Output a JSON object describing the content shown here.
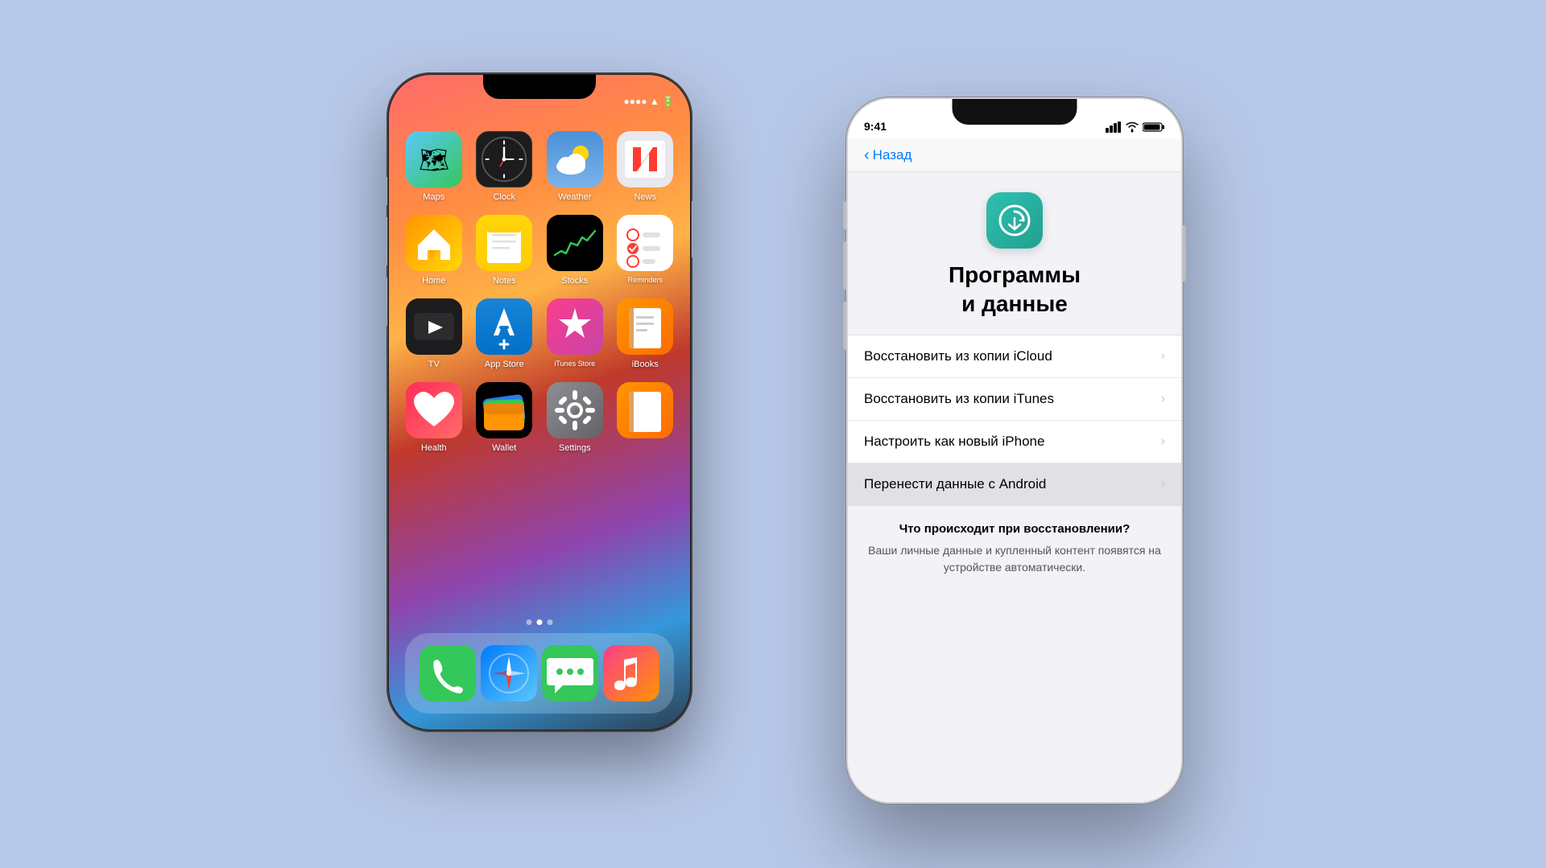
{
  "scene": {
    "background_color": "#b8c8e8"
  },
  "back_phone": {
    "apps_row1": [
      {
        "id": "maps",
        "label": "Maps",
        "bg_class": "maps-bg",
        "icon": "🗺️"
      },
      {
        "id": "clock",
        "label": "Clock",
        "bg_class": "clock-bg",
        "icon": "🕐"
      },
      {
        "id": "weather",
        "label": "Weather",
        "bg_class": "weather-bg",
        "icon": "⛅"
      },
      {
        "id": "news",
        "label": "News",
        "bg_class": "news-bg",
        "icon": "📰"
      }
    ],
    "apps_row2": [
      {
        "id": "home",
        "label": "Home",
        "bg_class": "home-bg",
        "icon": "🏠"
      },
      {
        "id": "notes",
        "label": "Notes",
        "bg_class": "notes-bg",
        "icon": "📝"
      },
      {
        "id": "stocks",
        "label": "Stocks",
        "bg_class": "stocks-bg",
        "icon": "📈"
      },
      {
        "id": "reminders",
        "label": "Reminders",
        "bg_class": "reminders-bg",
        "icon": "🔔"
      }
    ],
    "apps_row3": [
      {
        "id": "tv",
        "label": "TV",
        "bg_class": "tv-bg",
        "icon": "📺"
      },
      {
        "id": "appstore",
        "label": "App Store",
        "bg_class": "appstore-bg",
        "icon": "Ⓐ"
      },
      {
        "id": "itunes",
        "label": "iTunes Store",
        "bg_class": "itunes-bg",
        "icon": "⭐"
      },
      {
        "id": "ibooks",
        "label": "iBooks",
        "bg_class": "ibooks-bg",
        "icon": "📚"
      }
    ],
    "apps_row4": [
      {
        "id": "health",
        "label": "Health",
        "bg_class": "health-bg",
        "icon": "❤️"
      },
      {
        "id": "wallet",
        "label": "Wallet",
        "bg_class": "wallet-bg",
        "icon": "💳"
      },
      {
        "id": "settings",
        "label": "Settings",
        "bg_class": "settings-bg",
        "icon": "⚙️"
      },
      {
        "id": "extra",
        "label": "",
        "bg_class": "ibooks-bg",
        "icon": "📖"
      }
    ],
    "dock": [
      {
        "id": "phone",
        "label": "Phone",
        "bg_class": "phone-dock-bg",
        "icon": "📞"
      },
      {
        "id": "safari",
        "label": "Safari",
        "bg_class": "safari-dock-bg",
        "icon": "🧭"
      },
      {
        "id": "messages",
        "label": "Messages",
        "bg_class": "messages-dock-bg",
        "icon": "💬"
      },
      {
        "id": "music",
        "label": "Music",
        "bg_class": "music-dock-bg",
        "icon": "🎵"
      }
    ]
  },
  "front_phone": {
    "status_bar": {
      "time": "9:41",
      "signal_bars": "●●●●",
      "wifi": "wifi",
      "battery": "battery"
    },
    "nav": {
      "back_label": "Назад"
    },
    "header": {
      "icon_type": "restore",
      "title_line1": "Программы",
      "title_line2": "и данные"
    },
    "menu_items": [
      {
        "id": "icloud-restore",
        "text": "Восстановить из копии iCloud",
        "active": false
      },
      {
        "id": "itunes-restore",
        "text": "Восстановить из копии iTunes",
        "active": false
      },
      {
        "id": "new-iphone",
        "text": "Настроить как новый iPhone",
        "active": false
      },
      {
        "id": "android-transfer",
        "text": "Перенести данные с Android",
        "active": true
      }
    ],
    "info_section": {
      "title": "Что происходит при восстановлении?",
      "text": "Ваши личные данные и купленный контент появятся на устройстве автоматически."
    }
  }
}
